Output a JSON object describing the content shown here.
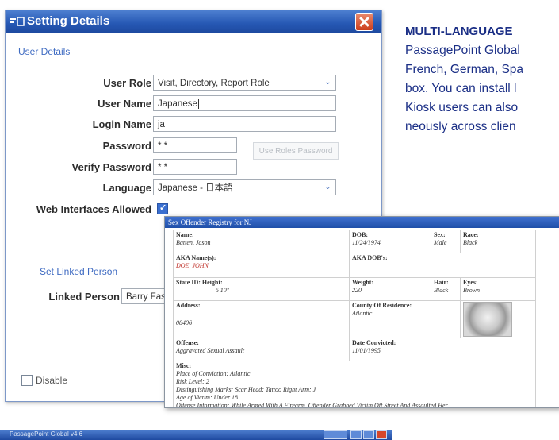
{
  "window": {
    "title": "Setting Details",
    "section_user_details": "User Details",
    "section_linked_person": "Set Linked Person",
    "user_role": {
      "label": "User Role",
      "value": "Visit, Directory, Report Role"
    },
    "user_name": {
      "label": "User Name",
      "value": "Japanese"
    },
    "login_name": {
      "label": "Login Name",
      "value": "ja"
    },
    "password": {
      "label": "Password",
      "value": "* *",
      "button": "Use Roles Password"
    },
    "verify_password": {
      "label": "Verify Password",
      "value": "* *"
    },
    "language": {
      "label": "Language",
      "value": "Japanese - 日本語"
    },
    "web_interfaces": {
      "label": "Web Interfaces Allowed"
    },
    "linked_person": {
      "label": "Linked Person",
      "value": "Barry Fassel"
    },
    "disable_label": "Disable"
  },
  "article": {
    "heading": "MULTI-LANGUAGE",
    "lines": [
      "PassagePoint Global",
      "French, German, Spa",
      "box. You can install l",
      "Kiosk users can also",
      "neously across clien"
    ]
  },
  "registry": {
    "title": "Sex Offender Registry for NJ",
    "name_label": "Name:",
    "name_value": "Batten, Jason",
    "dob_label": "DOB:",
    "dob_value": "11/24/1974",
    "sex_label": "Sex:",
    "sex_value": "Male",
    "race_label": "Race:",
    "race_value": "Black",
    "aka_label": "AKA Name(s):",
    "aka_value": "DOE, JOHN",
    "aka_dob_label": "AKA DOB's:",
    "stateid_label": "State ID: Height:",
    "height_value": "5'10\"",
    "weight_label": "Weight:",
    "weight_value": "220",
    "hair_label": "Hair:",
    "hair_value": "Black",
    "eyes_label": "Eyes:",
    "eyes_value": "Brown",
    "address_label": "Address:",
    "address_value": "08406",
    "county_label": "County Of Residence:",
    "county_value": "Atlantic",
    "offense_label": "Offense:",
    "offense_value": "Aggravated Sexual Assault",
    "date_label": "Date Convicted:",
    "date_value": "11/01/1995",
    "misc_label": "Misc:",
    "misc_lines": [
      "Place of Conviction: Atlantic",
      "Risk Level: 2",
      "Distinguishing Marks: Scar Head; Tattoo Right Arm: J",
      "Age of Victim: Under 18",
      "Offense Information: While Armed With A Firearm, Offender Grabbed Victim Off Street And Assaulted Her."
    ]
  },
  "taskbar": {
    "title": "PassagePoint Global v4.6"
  },
  "colors": {
    "title_bar": "#2658b4",
    "article_text": "#1b2f86",
    "close_button": "#cc3e1c"
  }
}
